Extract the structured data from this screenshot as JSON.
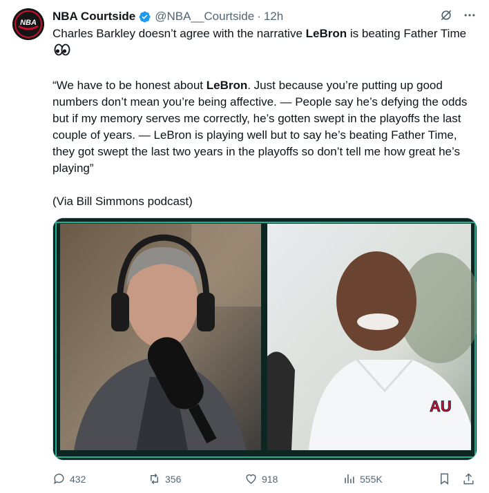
{
  "account": {
    "name": "NBA Courtside",
    "handle": "@NBA__Courtside",
    "separator": "·",
    "time": "12h",
    "avatar_text": "NBA",
    "verified_icon": "verified-badge-icon"
  },
  "post": {
    "line1_before": "Charles Barkley doesn’t agree with the narrative ",
    "line1_bold": "LeBron",
    "line1_after": " is beating Father Time",
    "emoji": "eyes-emoji",
    "quote_before": "“We have to be honest about ",
    "quote_bold": "LeBron",
    "quote_after": ". Just because you’re putting up good numbers don’t mean you’re being affective. — People say he’s defying the odds but if my memory serves me correctly, he’s gotten swept in the playoffs the last couple of years. — LeBron is playing well but to say he’s beating Father Time, they got swept the last two years in the playoffs so don’t tell me how great he’s playing”",
    "source": "(Via Bill Simmons podcast)"
  },
  "media": {
    "left_panel": "podcast-host-photo",
    "right_panel": "charles-barkley-photo",
    "frame_color": "#1fd6b3"
  },
  "actions": {
    "replies": "432",
    "reposts": "356",
    "likes": "918",
    "views": "555K"
  },
  "colors": {
    "text": "#0f1419",
    "secondary": "#536471",
    "verified": "#1d9bf0"
  }
}
